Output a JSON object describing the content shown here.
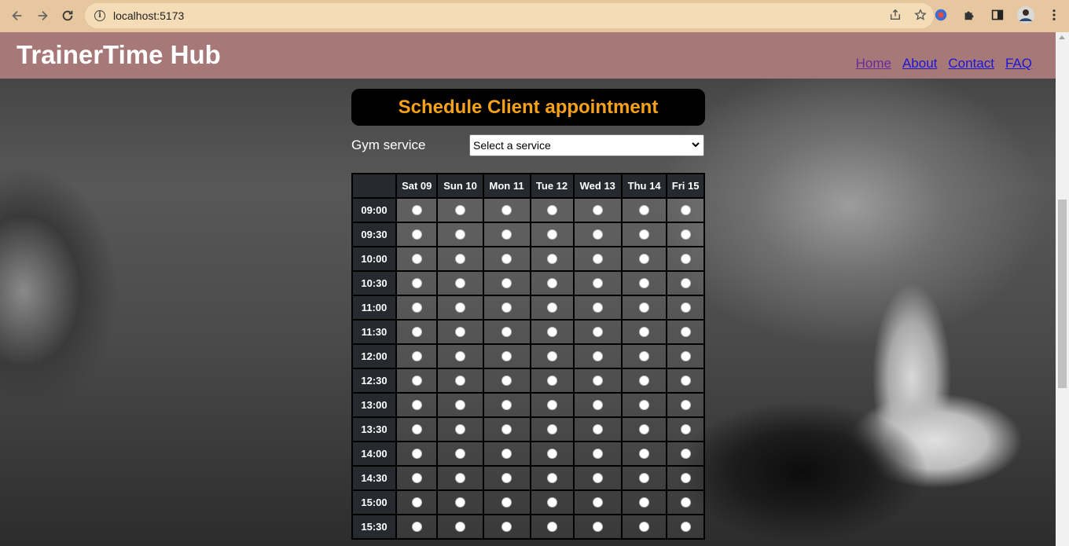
{
  "browser": {
    "url": "localhost:5173"
  },
  "header": {
    "brand": "TrainerTime Hub",
    "nav": [
      "Home",
      "About",
      "Contact",
      "FAQ"
    ]
  },
  "form": {
    "title": "Schedule Client appointment",
    "service_label": "Gym service",
    "service_selected": "Select a service"
  },
  "schedule": {
    "days": [
      "Sat 09",
      "Sun 10",
      "Mon 11",
      "Tue 12",
      "Wed 13",
      "Thu 14",
      "Fri 15"
    ],
    "times": [
      "09:00",
      "09:30",
      "10:00",
      "10:30",
      "11:00",
      "11:30",
      "12:00",
      "12:30",
      "13:00",
      "13:30",
      "14:00",
      "14:30",
      "15:00",
      "15:30"
    ]
  },
  "colors": {
    "chrome": "#e6c7a0",
    "header": "#a67878",
    "title_text": "#f5a11a",
    "link": "#1c14d6"
  }
}
